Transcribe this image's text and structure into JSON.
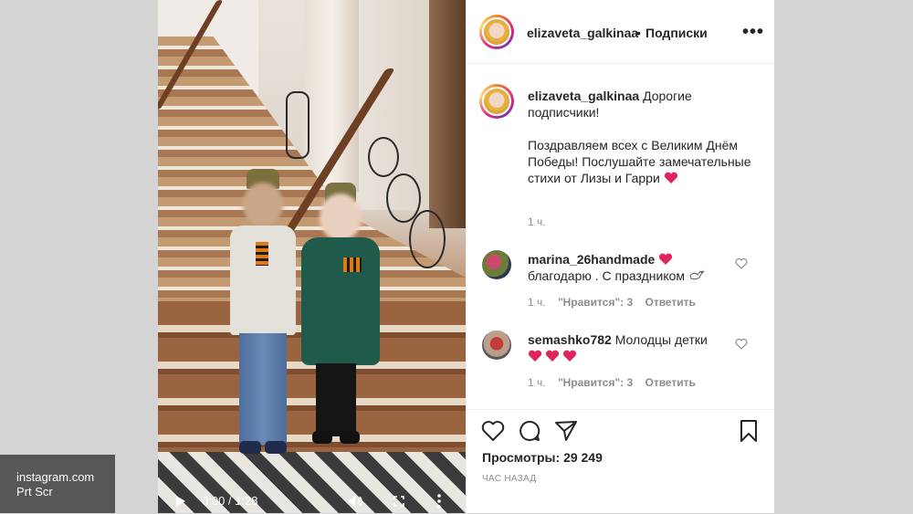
{
  "video": {
    "time": "0:00 / 1:28"
  },
  "watermark": {
    "line1": "instagram.com",
    "line2": "Prt Scr"
  },
  "header": {
    "username": "elizaveta_galkinaa",
    "separator": "•",
    "follow_label": "Подписки",
    "more_label": "•••"
  },
  "caption": {
    "username": "elizaveta_galkinaa",
    "line1": "Дорогие подписчики!",
    "line2": "Поздравляем всех с Великим Днём Победы! Послушайте замечательные стихи от Лизы и Гарри",
    "time": "1 ч."
  },
  "comments": [
    {
      "username": "marina_26handmade",
      "text": "благодарю . С праздником",
      "time": "1 ч.",
      "likes": "\"Нравится\": 3",
      "reply": "Ответить"
    },
    {
      "username": "semashko782",
      "text": "Молодцы детки",
      "time": "1 ч.",
      "likes": "\"Нравится\": 3",
      "reply": "Ответить"
    }
  ],
  "stats": {
    "views_label": "Просмотры:",
    "views_value": "29 249",
    "date": "ЧАС НАЗАД"
  },
  "colors": {
    "heart_red": "#e0245e",
    "text_primary": "#262626",
    "text_secondary": "#8e8e8e"
  }
}
